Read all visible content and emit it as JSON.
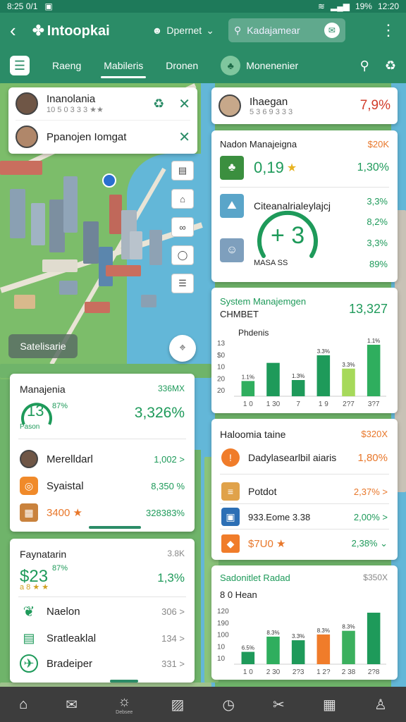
{
  "status": {
    "time_left": "8:25 0/1",
    "battery": "19%",
    "time_right": "12:20"
  },
  "appbar": {
    "title": "Intoopkai",
    "account": "Dpernet",
    "search_placeholder": "Kadajamear"
  },
  "tabs": {
    "t1": "Raeng",
    "t2": "Mabileris",
    "t3": "Dronen",
    "t4": "Monenenier"
  },
  "contacts": [
    {
      "name": "Inanolania",
      "meta": "10 5 0 3 3 3 ★★"
    },
    {
      "name": "Ppanojen Iomgat"
    }
  ],
  "map_label": "Satelisarie",
  "right_top": {
    "name": "Ihaegan",
    "meta": "5 3 6 9 3 3 3",
    "value": "7,9%"
  },
  "rank_card": {
    "title": "Nadon Manajeigna",
    "title_val": "$20K",
    "row1_val": "0,19",
    "row1_star": "★",
    "row1_pct": "1,30%",
    "row2_label": "Citeanalrialeylajcj",
    "row2_pct": "3,3%",
    "gauge_val": "+ 3",
    "row3_pct": "8,2%",
    "row4_pct": "3,3%",
    "footer": "MASA SS",
    "footer_val": "89%"
  },
  "system_chart": {
    "title": "System Manajemgen",
    "subtitle": "CHMBET",
    "value": "13,327"
  },
  "manage_card": {
    "title": "Manajenia",
    "title_val": "336MX",
    "gauge": "13",
    "gauge_pct": "87%",
    "big_pct": "3,326%",
    "gauge_label": "Pason",
    "rows": [
      {
        "label": "Merelldarl",
        "val": "1,002 >"
      },
      {
        "label": "Syaistal",
        "val": "8,350 %"
      },
      {
        "label": "3400 ★",
        "val": "328383%"
      }
    ]
  },
  "holdings_card": {
    "title": "Haloomia taine",
    "title_val": "$320X",
    "rows": [
      {
        "label": "Dadylasearlbil aiaris",
        "val": "1,80%"
      },
      {
        "label": "Potdot",
        "val": "2,37% >"
      },
      {
        "label": "933.Eome 3.38",
        "val": "2,00% >"
      },
      {
        "label": "$7U0 ★",
        "val": "2,38% ⌄"
      }
    ]
  },
  "forecast_card": {
    "title": "Faynatarin",
    "title_val": "3.8K",
    "big": "$23",
    "big_pct": "87%",
    "pct": "1,3%",
    "stars": "a 8 ★ ★",
    "rows": [
      {
        "label": "Naelon",
        "val": "306 >"
      },
      {
        "label": "Sratleaklal",
        "val": "134 >"
      },
      {
        "label": "Bradeiper",
        "val": "331 >"
      }
    ]
  },
  "bottom_chart": {
    "title": "Sadonitlet Radad",
    "title_val": "$350X",
    "subtitle": "8 0 Hean"
  },
  "bottom_nav": {
    "label2": "Debsee"
  },
  "colors": {
    "primary": "#2b8c67",
    "accent_green": "#1e9a5a",
    "accent_orange": "#e8772a"
  },
  "chart_data": [
    {
      "type": "bar",
      "title": "Phdenis",
      "categories": [
        "1 0",
        "1 30",
        "7",
        "1 9",
        "2?7",
        "3?7"
      ],
      "values": [
        16,
        35,
        17,
        43,
        29,
        54
      ],
      "value_labels": [
        "1.1%",
        "",
        "1.3%",
        "3.3%",
        "3.3%",
        "1.1%"
      ],
      "ylabels": [
        "13",
        "$0",
        "10",
        "20",
        "20"
      ],
      "colors": [
        "#2fae5e",
        "#1e9a5a",
        "#1e9a5a",
        "#1e9a5a",
        "#a6d95a",
        "#2fae5e"
      ]
    },
    {
      "type": "bar",
      "categories": [
        "1 0",
        "2 30",
        "2?3",
        "1 2?",
        "2 38",
        "2?8"
      ],
      "values": [
        17,
        38,
        33,
        41,
        46,
        71
      ],
      "value_labels": [
        "6.5%",
        "8.3%",
        "3.3%",
        "8.3%",
        "8.3%",
        ""
      ],
      "ylabels": [
        "120",
        "190",
        "100",
        "10",
        "10"
      ],
      "colors": [
        "#1e9a5a",
        "#2fae5e",
        "#1e9a5a",
        "#f07c2a",
        "#3bb05e",
        "#1e9a5a"
      ]
    }
  ]
}
